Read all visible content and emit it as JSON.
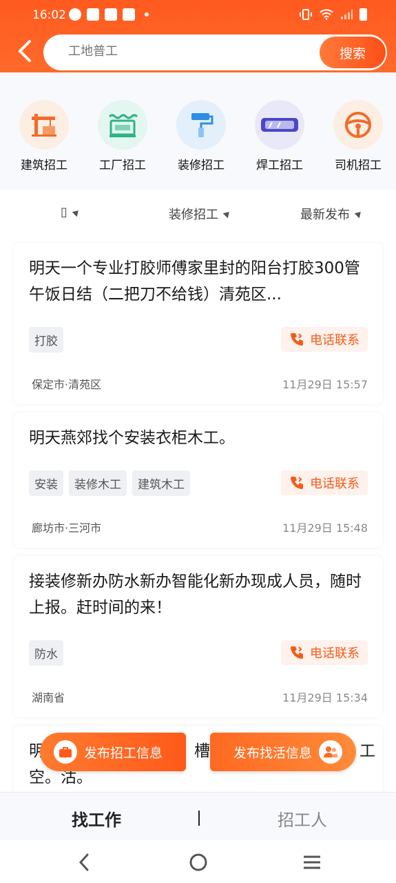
{
  "status": {
    "time": "16:02"
  },
  "search": {
    "placeholder": "工地普工",
    "button_label": "搜索"
  },
  "categories": [
    {
      "label": "建筑招工",
      "icon": "crane-icon",
      "color": "#f26b2a",
      "bg": "#fdeee3"
    },
    {
      "label": "工厂招工",
      "icon": "factory-icon",
      "color": "#2fb38a",
      "bg": "#e3f6ef"
    },
    {
      "label": "装修招工",
      "icon": "paint-roller-icon",
      "color": "#2d8ee6",
      "bg": "#e3f0fb"
    },
    {
      "label": "焊工招工",
      "icon": "welding-goggles-icon",
      "color": "#4b47c9",
      "bg": "#e8e8f8"
    },
    {
      "label": "司机招工",
      "icon": "steering-wheel-icon",
      "color": "#f26b2a",
      "bg": "#fdeee3"
    }
  ],
  "filters": {
    "region": "▯",
    "category": "装修招工",
    "sort": "最新发布"
  },
  "jobs": [
    {
      "title": "明天一个专业打胶师傅家里封的阳台打胶300管午饭日结（二把刀不给钱）清苑区...",
      "tags": [
        "打胶"
      ],
      "call_label": "电话联系",
      "location": "保定市·清苑区",
      "time": "11月29日 15:57"
    },
    {
      "title": "明天燕郊找个安装衣柜木工。",
      "tags": [
        "安装",
        "装修木工",
        "建筑木工"
      ],
      "call_label": "电话联系",
      "location": "廊坊市·三河市",
      "time": "11月29日 15:48"
    },
    {
      "title": "接装修新办防水新办智能化新办现成人员，随时上报。赶时间的来！",
      "tags": [
        "防水"
      ],
      "call_label": "电话联系",
      "location": "湖南省",
      "time": "11月29日 15:34"
    },
    {
      "title": "明",
      "title_tail": "槽砸",
      "title_end": "工",
      "title_line2": "空。沽。"
    }
  ],
  "float_buttons": {
    "post_recruit": "发布招工信息",
    "post_findwork": "发布找活信息"
  },
  "tabs": {
    "find_work": "找工作",
    "recruit": "招工人"
  },
  "colors": {
    "brand": "#ff5a1f",
    "accent_light": "#fff2ec"
  }
}
